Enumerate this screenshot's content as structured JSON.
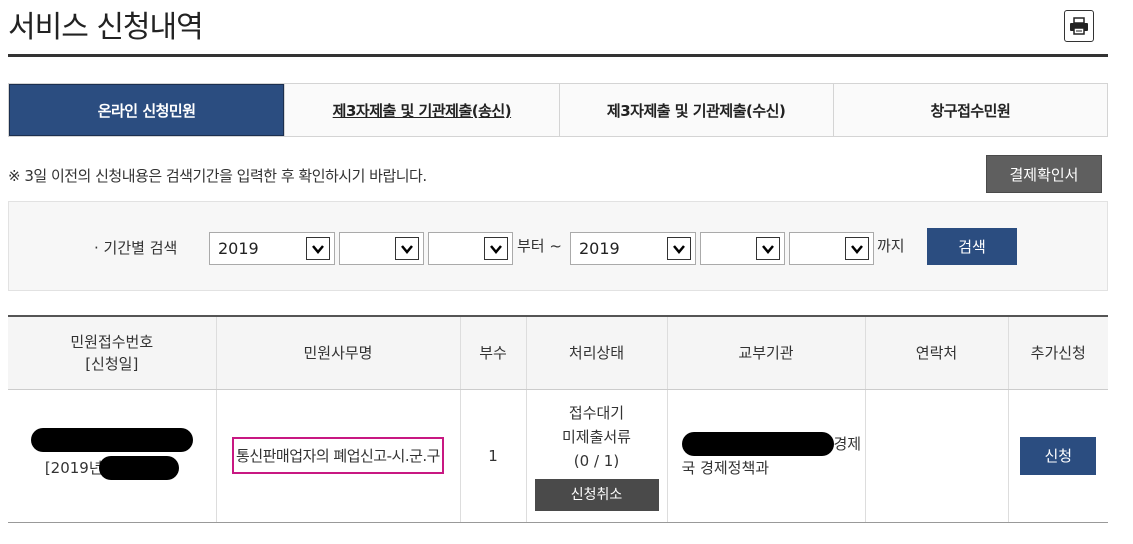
{
  "page": {
    "title": "서비스 신청내역",
    "print_icon": "printer-icon"
  },
  "tabs": [
    {
      "label": "온라인 신청민원",
      "active": true
    },
    {
      "label": "제3자제출 및 기관제출(송신)",
      "active": false
    },
    {
      "label": "제3자제출 및 기관제출(수신)",
      "active": false
    },
    {
      "label": "창구접수민원",
      "active": false
    }
  ],
  "notice": "※ 3일 이전의 신청내용은 검색기간을 입력한 후 확인하시기 바랍니다.",
  "confirm_button": "결제확인서",
  "search": {
    "label": "· 기간별 검색",
    "from_year": "2019",
    "from_month": "",
    "from_day": "",
    "from_text": "부터 ~",
    "to_year": "2019",
    "to_month": "",
    "to_day": "",
    "to_text": "까지",
    "button": "검색"
  },
  "table": {
    "headers": {
      "receipt_line1": "민원접수번호",
      "receipt_line2": "[신청일]",
      "service": "민원사무명",
      "copies": "부수",
      "status": "처리상태",
      "agency": "교부기관",
      "contact": "연락처",
      "additional": "추가신청"
    },
    "row": {
      "date_prefix": "[2019년",
      "service_name": "통신판매업자의 폐업신고-시.군.구",
      "copies": "1",
      "status_line1": "접수대기",
      "status_line2": "미제출서류",
      "status_line3": "(0 / 1)",
      "cancel_button": "신청취소",
      "agency_suffix": "경제",
      "agency_line2": "국 경제정책과",
      "contact": "",
      "apply_button": "신청"
    }
  }
}
